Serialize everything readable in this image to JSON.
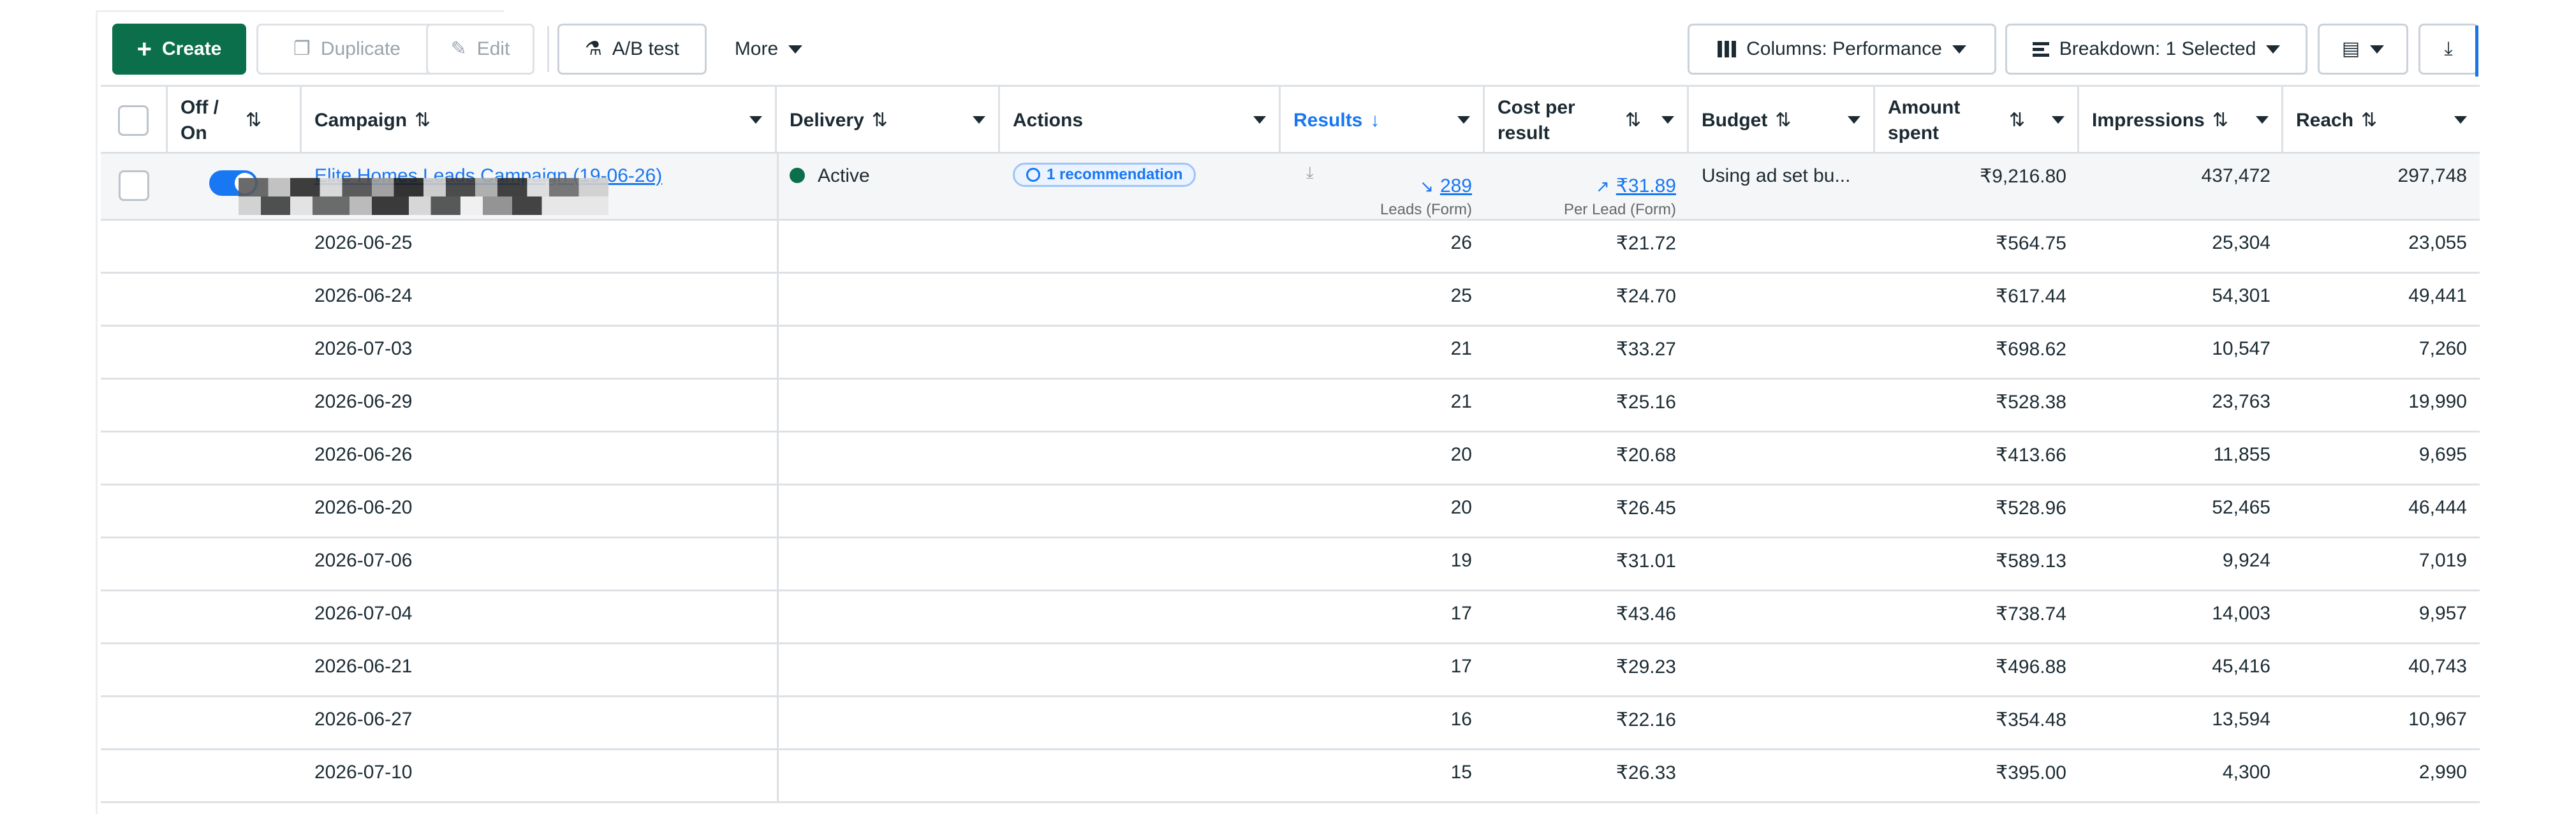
{
  "toolbar": {
    "create_label": "Create",
    "duplicate_label": "Duplicate",
    "edit_label": "Edit",
    "ab_test_label": "A/B test",
    "more_label": "More",
    "columns_label": "Columns: Performance",
    "breakdown_label": "Breakdown: 1 Selected"
  },
  "table": {
    "headers": {
      "off_on": "Off / On",
      "campaign": "Campaign",
      "delivery": "Delivery",
      "actions": "Actions",
      "results": "Results",
      "cost_per_result": "Cost per result",
      "budget": "Budget",
      "amount_spent": "Amount spent",
      "impressions": "Impressions",
      "reach": "Reach"
    },
    "campaign_row": {
      "name": "Elite Homes Leads Campaign (19-06-26)",
      "delivery": "Active",
      "recommendation": "1 recommendation",
      "results": "289",
      "results_sub": "Leads (Form)",
      "cost_per_result": "₹31.89",
      "cost_sub": "Per Lead (Form)",
      "budget": "Using ad set bu...",
      "amount_spent": "₹9,216.80",
      "impressions": "437,472",
      "reach": "297,748"
    },
    "rows": [
      {
        "date": "2026-06-25",
        "results": "26",
        "cost": "₹21.72",
        "spent": "₹564.75",
        "impressions": "25,304",
        "reach": "23,055"
      },
      {
        "date": "2026-06-24",
        "results": "25",
        "cost": "₹24.70",
        "spent": "₹617.44",
        "impressions": "54,301",
        "reach": "49,441"
      },
      {
        "date": "2026-07-03",
        "results": "21",
        "cost": "₹33.27",
        "spent": "₹698.62",
        "impressions": "10,547",
        "reach": "7,260"
      },
      {
        "date": "2026-06-29",
        "results": "21",
        "cost": "₹25.16",
        "spent": "₹528.38",
        "impressions": "23,763",
        "reach": "19,990"
      },
      {
        "date": "2026-06-26",
        "results": "20",
        "cost": "₹20.68",
        "spent": "₹413.66",
        "impressions": "11,855",
        "reach": "9,695"
      },
      {
        "date": "2026-06-20",
        "results": "20",
        "cost": "₹26.45",
        "spent": "₹528.96",
        "impressions": "52,465",
        "reach": "46,444"
      },
      {
        "date": "2026-07-06",
        "results": "19",
        "cost": "₹31.01",
        "spent": "₹589.13",
        "impressions": "9,924",
        "reach": "7,019"
      },
      {
        "date": "2026-07-04",
        "results": "17",
        "cost": "₹43.46",
        "spent": "₹738.74",
        "impressions": "14,003",
        "reach": "9,957"
      },
      {
        "date": "2026-06-21",
        "results": "17",
        "cost": "₹29.23",
        "spent": "₹496.88",
        "impressions": "45,416",
        "reach": "40,743"
      },
      {
        "date": "2026-06-27",
        "results": "16",
        "cost": "₹22.16",
        "spent": "₹354.48",
        "impressions": "13,594",
        "reach": "10,967"
      },
      {
        "date": "2026-07-10",
        "results": "15",
        "cost": "₹26.33",
        "spent": "₹395.00",
        "impressions": "4,300",
        "reach": "2,990"
      }
    ]
  },
  "colors": {
    "primary": "#0a6f4a",
    "link": "#1877f2",
    "border": "#dde1e5",
    "active_dot": "#0a6f4a"
  }
}
